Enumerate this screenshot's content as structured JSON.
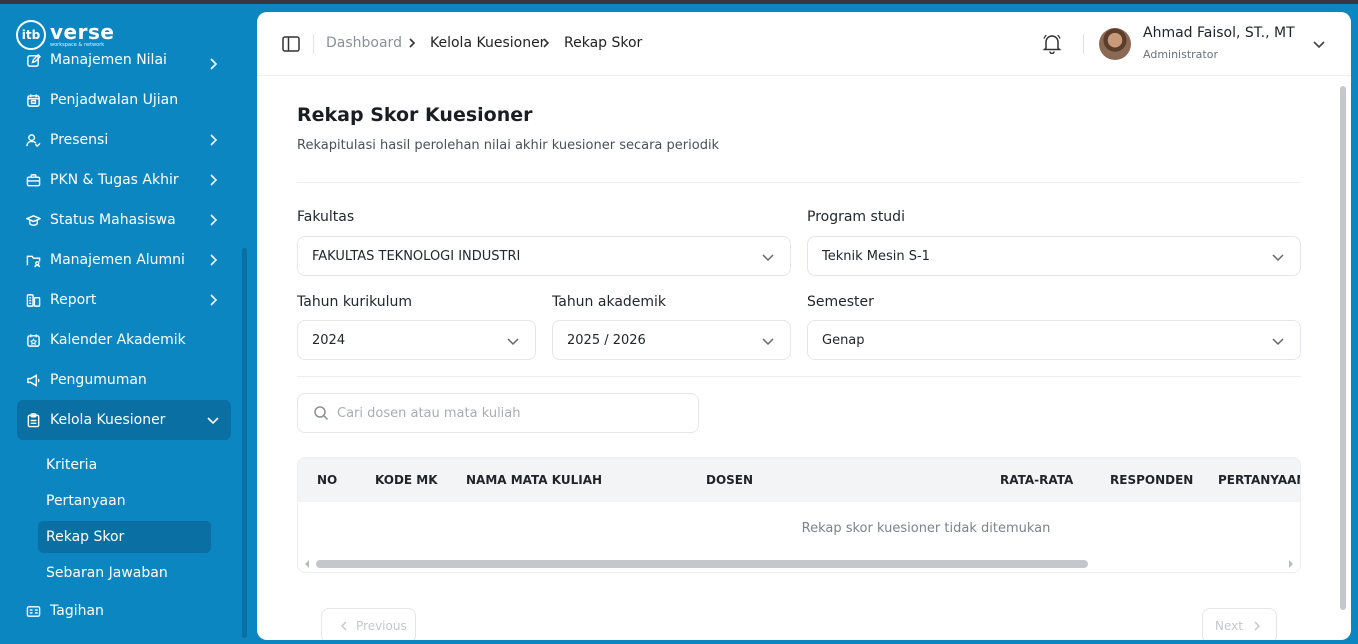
{
  "app": {
    "logo_text": "verse",
    "logo_tagline": "workspace & network",
    "logo_mark": "itb"
  },
  "sidebar": {
    "items": [
      {
        "label": "Manajemen Nilai",
        "icon": "edit-square-icon",
        "has_children": true
      },
      {
        "label": "Penjadwalan Ujian",
        "icon": "calendar-icon",
        "has_children": false
      },
      {
        "label": "Presensi",
        "icon": "user-check-icon",
        "has_children": true
      },
      {
        "label": "PKN & Tugas Akhir",
        "icon": "briefcase-icon",
        "has_children": true
      },
      {
        "label": "Status Mahasiswa",
        "icon": "graduation-cap-icon",
        "has_children": true
      },
      {
        "label": "Manajemen Alumni",
        "icon": "folder-user-icon",
        "has_children": true
      },
      {
        "label": "Report",
        "icon": "chart-report-icon",
        "has_children": true
      },
      {
        "label": "Kalender Akademik",
        "icon": "calendar-star-icon",
        "has_children": false
      },
      {
        "label": "Pengumuman",
        "icon": "megaphone-icon",
        "has_children": false
      },
      {
        "label": "Kelola Kuesioner",
        "icon": "clipboard-icon",
        "has_children": true,
        "expanded": true,
        "active": true
      },
      {
        "label": "Tagihan",
        "icon": "receipt-icon",
        "has_children": false
      }
    ],
    "subitems": [
      {
        "label": "Kriteria",
        "active": false
      },
      {
        "label": "Pertanyaan",
        "active": false
      },
      {
        "label": "Rekap Skor",
        "active": true
      },
      {
        "label": "Sebaran Jawaban",
        "active": false
      }
    ]
  },
  "header": {
    "breadcrumb": [
      "Dashboard",
      "Kelola Kuesioner",
      "Rekap Skor"
    ],
    "user_name": "Ahmad Faisol, ST., MT",
    "user_role": "Administrator"
  },
  "page": {
    "title": "Rekap Skor Kuesioner",
    "subtitle": "Rekapitulasi hasil perolehan nilai akhir kuesioner secara periodik"
  },
  "filters": {
    "fakultas": {
      "label": "Fakultas",
      "value": "FAKULTAS TEKNOLOGI INDUSTRI"
    },
    "prodi": {
      "label": "Program studi",
      "value": "Teknik Mesin S-1"
    },
    "kurikulum": {
      "label": "Tahun kurikulum",
      "value": "2024"
    },
    "akademik": {
      "label": "Tahun akademik",
      "value": "2025 / 2026"
    },
    "semester": {
      "label": "Semester",
      "value": "Genap"
    }
  },
  "search": {
    "placeholder": "Cari dosen atau mata kuliah",
    "value": ""
  },
  "table": {
    "columns": [
      "NO",
      "KODE MK",
      "NAMA MATA KULIAH",
      "DOSEN",
      "RATA-RATA",
      "RESPONDEN",
      "PERTANYAAN"
    ],
    "empty_message": "Rekap skor kuesioner tidak ditemukan"
  },
  "pagination": {
    "previous": "Previous",
    "next": "Next"
  },
  "colors": {
    "sidebar_bg": "#0c86c1",
    "sidebar_active": "#0a6fa3",
    "panel_bg": "#ffffff"
  }
}
